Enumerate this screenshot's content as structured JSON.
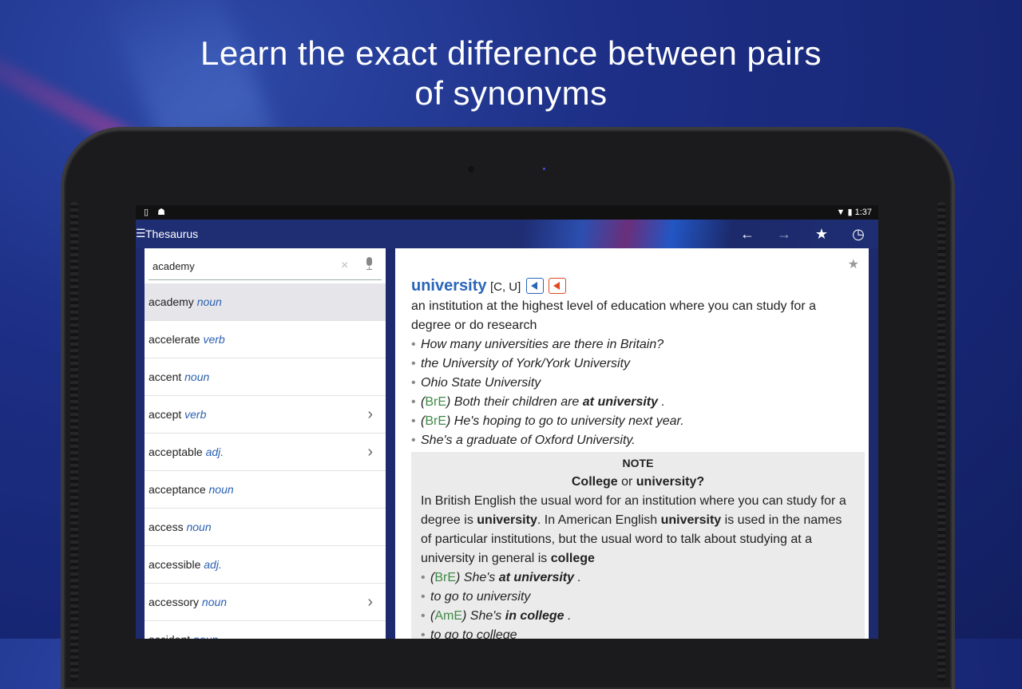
{
  "headline": {
    "line1": "Learn the exact difference between pairs",
    "line2": "of synonyms"
  },
  "status_bar": {
    "left_icons": [
      "tablet-icon",
      "android-icon"
    ],
    "right_icons": [
      "wifi-icon",
      "battery-icon"
    ],
    "time": "1:37"
  },
  "app_bar": {
    "title": "Thesaurus",
    "actions": [
      "back-arrow-icon",
      "forward-arrow-icon",
      "star-icon",
      "history-icon"
    ]
  },
  "search": {
    "value": "academy",
    "clear_icon": "×",
    "mic_icon": "mic-icon"
  },
  "word_list": [
    {
      "word": "academy",
      "pos": "noun",
      "selected": true,
      "chevron": false
    },
    {
      "word": "accelerate",
      "pos": "verb",
      "selected": false,
      "chevron": false
    },
    {
      "word": "accent",
      "pos": "noun",
      "selected": false,
      "chevron": false
    },
    {
      "word": "accept",
      "pos": "verb",
      "selected": false,
      "chevron": true
    },
    {
      "word": "acceptable",
      "pos": "adj.",
      "selected": false,
      "chevron": true
    },
    {
      "word": "acceptance",
      "pos": "noun",
      "selected": false,
      "chevron": false
    },
    {
      "word": "access",
      "pos": "noun",
      "selected": false,
      "chevron": false
    },
    {
      "word": "accessible",
      "pos": "adj.",
      "selected": false,
      "chevron": false
    },
    {
      "word": "accessory",
      "pos": "noun",
      "selected": false,
      "chevron": true
    },
    {
      "word": "accident",
      "pos": "noun",
      "selected": false,
      "chevron": false
    }
  ],
  "entry": {
    "headword": "university",
    "grammar": "[C, U]",
    "definition": "an institution at the highest level of education where you can study for a degree or do research",
    "examples": [
      {
        "register": "",
        "text": "How many universities are there in Britain?",
        "bold": "",
        "after": ""
      },
      {
        "register": "",
        "text": "the University of York/York University",
        "bold": "",
        "after": ""
      },
      {
        "register": "",
        "text": "Ohio State University",
        "bold": "",
        "after": ""
      },
      {
        "register": "BrE",
        "text": "Both their children are ",
        "bold": "at university",
        "after": " ."
      },
      {
        "register": "BrE",
        "text": "He's hoping to go to university next year.",
        "bold": "",
        "after": ""
      },
      {
        "register": "",
        "text": "She's a graduate of Oxford University.",
        "bold": "",
        "after": ""
      }
    ],
    "note": {
      "label": "NOTE",
      "heading_a": "College",
      "heading_or": " or ",
      "heading_b": "university?",
      "p1": "In British English the usual word for an institution where you can study for a degree is ",
      "b1": "university",
      "p2": ". In American English ",
      "b2": "university",
      "p3": " is used in the names of particular institutions, but the usual word to talk about studying at a university in general is ",
      "b3": "college",
      "examples": [
        {
          "register": "BrE",
          "text": "She's ",
          "bold": "at university",
          "after": " ."
        },
        {
          "register": "",
          "text": "to go to university",
          "bold": "",
          "after": ""
        },
        {
          "register": "AmE",
          "text": "She's ",
          "bold": "in college",
          "after": " ."
        },
        {
          "register": "",
          "text": "to go to college",
          "bold": "",
          "after": ""
        }
      ]
    }
  }
}
